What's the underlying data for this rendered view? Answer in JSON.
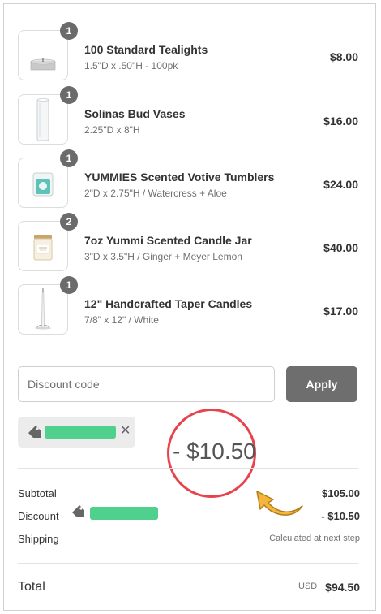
{
  "items": [
    {
      "qty": "1",
      "name": "100 Standard Tealights",
      "variant": "1.5\"D x .50\"H - 100pk",
      "price": "$8.00"
    },
    {
      "qty": "1",
      "name": "Solinas Bud Vases",
      "variant": "2.25\"D x 8\"H",
      "price": "$16.00"
    },
    {
      "qty": "1",
      "name": "YUMMIES Scented Votive Tumblers",
      "variant": "2\"D x 2.75\"H / Watercress + Aloe",
      "price": "$24.00"
    },
    {
      "qty": "2",
      "name": "7oz Yummi Scented Candle Jar",
      "variant": "3\"D x 3.5\"H / Ginger + Meyer Lemon",
      "price": "$40.00"
    },
    {
      "qty": "1",
      "name": "12\" Handcrafted Taper Candles",
      "variant": "7/8\" x 12\" / White",
      "price": "$17.00"
    }
  ],
  "discount": {
    "placeholder": "Discount code",
    "apply_label": "Apply",
    "applied_code_redacted": true,
    "applied_code_color": "#4fd08d",
    "remove_icon": "close-icon",
    "tag_icon": "tag-icon"
  },
  "annotation": {
    "amount": "- $10.50",
    "circle_color": "#e8424b",
    "arrow_color": "#f5b53a"
  },
  "summary": {
    "subtotal_label": "Subtotal",
    "subtotal_value": "$105.00",
    "discount_label": "Discount",
    "discount_value": "- $10.50",
    "shipping_label": "Shipping",
    "shipping_value": "Calculated at next step",
    "total_label": "Total",
    "currency": "USD",
    "total_value": "$94.50"
  },
  "colors": {
    "badge": "#6b6b6b",
    "apply_button": "#6e6e6e",
    "chip_bg": "#ececec"
  }
}
